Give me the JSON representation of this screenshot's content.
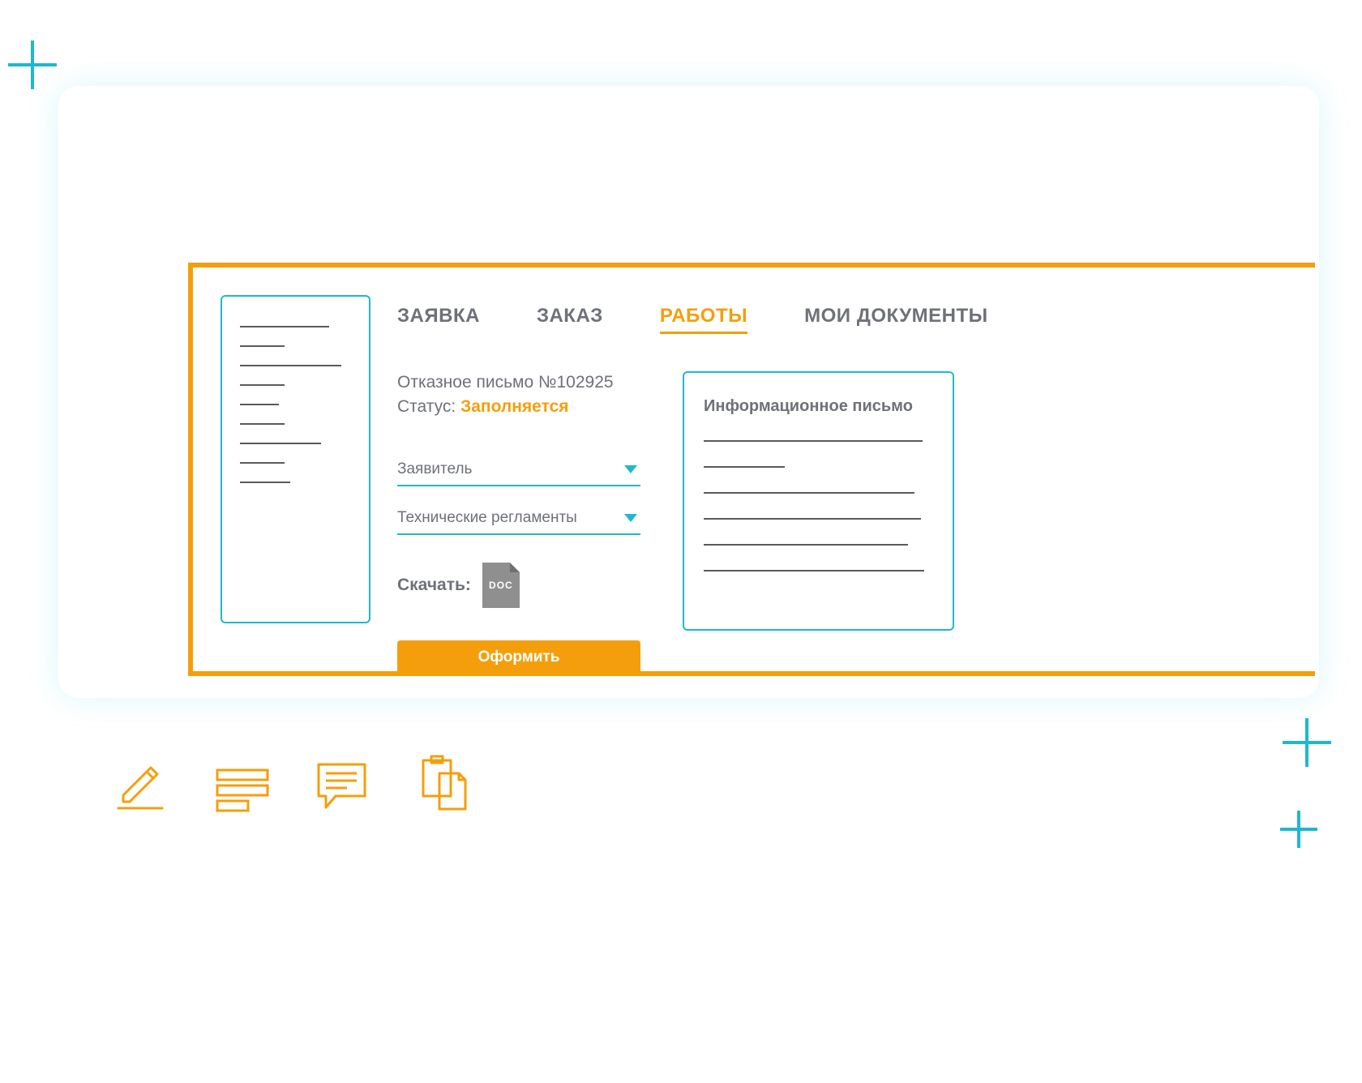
{
  "colors": {
    "accent_orange": "#f59e0b",
    "accent_cyan": "#1fb8cc",
    "text_muted": "#6e7178"
  },
  "tabs": {
    "items": [
      {
        "label": "ЗАЯВКА",
        "active": false
      },
      {
        "label": "ЗАКАЗ",
        "active": false
      },
      {
        "label": "РАБОТЫ",
        "active": true
      },
      {
        "label": "МОИ ДОКУМЕНТЫ",
        "active": false
      }
    ]
  },
  "document": {
    "title": "Отказное письмо №102925",
    "status_label": "Статус:",
    "status_value": "Заполняется"
  },
  "selects": {
    "applicant": {
      "label": "Заявитель"
    },
    "tech_regs": {
      "label": "Технические регламенты"
    }
  },
  "download": {
    "label": "Скачать:",
    "format": "DOC"
  },
  "submit": {
    "label": "Оформить"
  },
  "info_panel": {
    "title": "Информационное письмо"
  },
  "toolbar_icons": {
    "edit": "pencil-icon",
    "list": "list-icon",
    "chat": "chat-icon",
    "copy": "copy-icon"
  }
}
